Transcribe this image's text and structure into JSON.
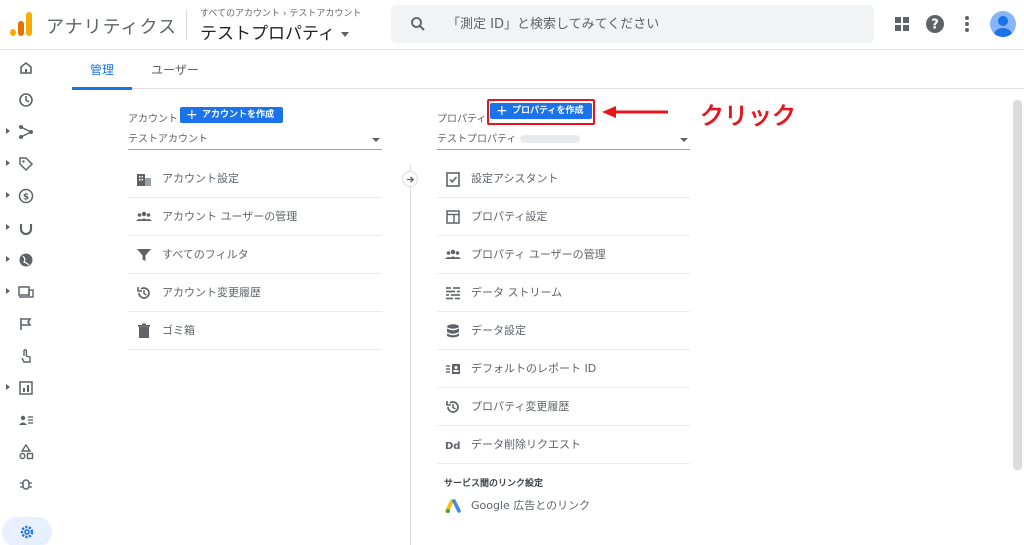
{
  "header": {
    "app_title": "アナリティクス",
    "breadcrumb": "すべてのアカウント › テストアカウント",
    "property_title": "テストプロパティ",
    "search_placeholder": "「測定 ID」と検索してみてください"
  },
  "tabs": [
    {
      "label": "管理",
      "active": true
    },
    {
      "label": "ユーザー",
      "active": false
    }
  ],
  "account": {
    "label": "アカウント",
    "create_button": "アカウントを作成",
    "selected": "テストアカウント",
    "items": [
      {
        "label": "アカウント設定",
        "icon": "building-icon"
      },
      {
        "label": "アカウント ユーザーの管理",
        "icon": "people-icon"
      },
      {
        "label": "すべてのフィルタ",
        "icon": "filter-icon"
      },
      {
        "label": "アカウント変更履歴",
        "icon": "history-icon"
      },
      {
        "label": "ゴミ箱",
        "icon": "trash-icon"
      }
    ]
  },
  "property": {
    "label": "プロパティ",
    "create_button": "プロパティを作成",
    "selected": "テストプロパティ",
    "items": [
      {
        "label": "設定アシスタント",
        "icon": "checklist-icon"
      },
      {
        "label": "プロパティ設定",
        "icon": "layout-icon"
      },
      {
        "label": "プロパティ ユーザーの管理",
        "icon": "people-icon"
      },
      {
        "label": "データ ストリーム",
        "icon": "stream-icon"
      },
      {
        "label": "データ設定",
        "icon": "database-icon"
      },
      {
        "label": "デフォルトのレポート ID",
        "icon": "id-card-icon"
      },
      {
        "label": "プロパティ変更履歴",
        "icon": "history-icon"
      },
      {
        "label": "データ削除リクエスト",
        "icon": "dd-icon"
      }
    ],
    "section_title": "サービス間のリンク設定",
    "link_items": [
      {
        "label": "Google 広告とのリンク",
        "icon": "google-ads-icon"
      }
    ]
  },
  "annotation": {
    "text": "クリック",
    "color": "#e8141e"
  },
  "colors": {
    "accent": "#1a73e8",
    "annotation": "#e8141e"
  }
}
